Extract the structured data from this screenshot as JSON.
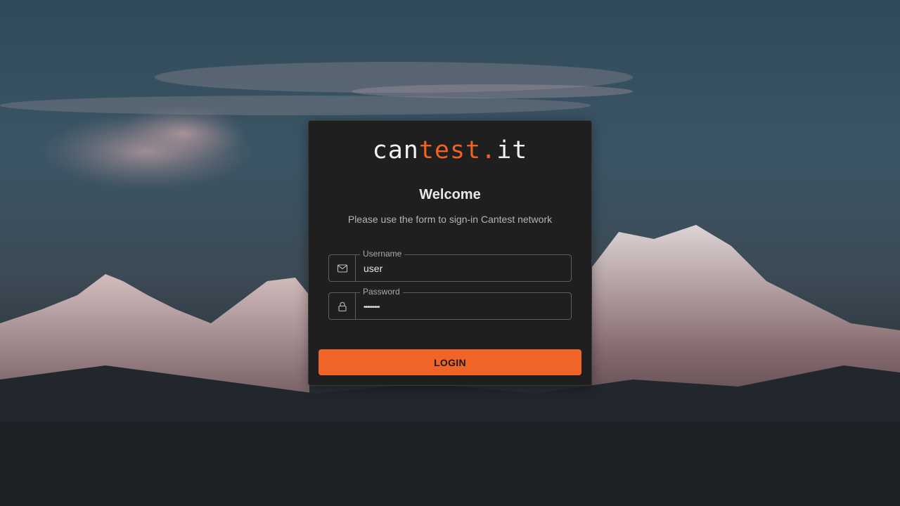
{
  "logo": {
    "part1": "can",
    "part2": "test.",
    "part3": "it"
  },
  "title": "Welcome",
  "subtitle": "Please use the form to sign-in Cantest network",
  "username": {
    "label": "Username",
    "value": "user",
    "icon": "mail-icon"
  },
  "password": {
    "label": "Password",
    "value": "•••••••••",
    "icon": "lock-icon"
  },
  "login_button": "LOGIN",
  "colors": {
    "accent": "#f16427",
    "card": "#1f1f1f"
  }
}
